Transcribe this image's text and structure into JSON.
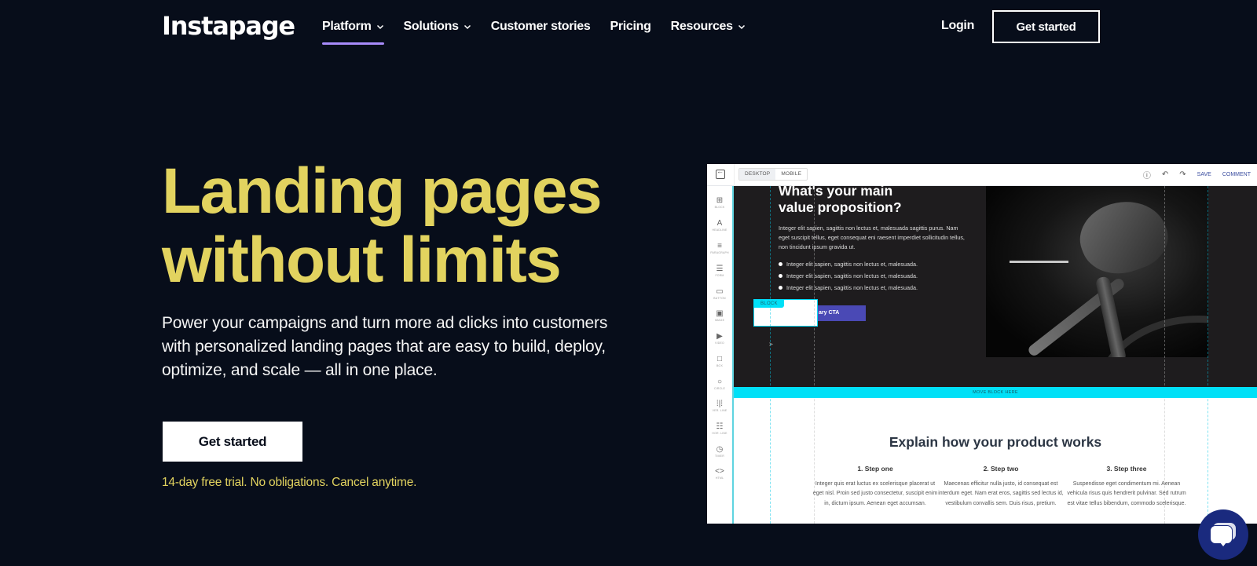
{
  "nav": {
    "logo": "Instapage",
    "items": [
      {
        "label": "Platform",
        "dropdown": true,
        "active": true
      },
      {
        "label": "Solutions",
        "dropdown": true,
        "active": false
      },
      {
        "label": "Customer stories",
        "dropdown": false,
        "active": false
      },
      {
        "label": "Pricing",
        "dropdown": false,
        "active": false
      },
      {
        "label": "Resources",
        "dropdown": true,
        "active": false
      }
    ],
    "login": "Login",
    "cta": "Get started"
  },
  "hero": {
    "title_line1": "Landing pages",
    "title_line2": "without limits",
    "subtitle": "Power your campaigns and turn more ad clicks into customers with personalized landing pages that are easy to build, deploy, optimize, and scale — all in one place.",
    "cta": "Get started",
    "trial_note": "14-day free trial. No obligations. Cancel anytime."
  },
  "editor": {
    "view_toggle": [
      "DESKTOP",
      "MOBILE"
    ],
    "active_view": "DESKTOP",
    "toolbar_right": {
      "help_icon": "question-circle-icon",
      "undo_icon": "undo-icon",
      "redo_icon": "redo-icon",
      "save": "SAVE",
      "comment": "COMMENT"
    },
    "tools": [
      {
        "label": "BLOCK",
        "icon": "block-icon",
        "glyph": "⊞"
      },
      {
        "label": "HEADLINE",
        "icon": "headline-icon",
        "glyph": "A"
      },
      {
        "label": "PARAGRAPH",
        "icon": "paragraph-icon",
        "glyph": "≡"
      },
      {
        "label": "FORM",
        "icon": "form-icon",
        "glyph": "☰"
      },
      {
        "label": "BUTTON",
        "icon": "button-icon",
        "glyph": "▭"
      },
      {
        "label": "IMAGE",
        "icon": "image-icon",
        "glyph": "▣"
      },
      {
        "label": "VIDEO",
        "icon": "video-icon",
        "glyph": "▶"
      },
      {
        "label": "BOX",
        "icon": "box-icon",
        "glyph": "□"
      },
      {
        "label": "CIRCLE",
        "icon": "circle-icon",
        "glyph": "○"
      },
      {
        "label": "VER. LINE",
        "icon": "vertical-line-icon",
        "glyph": "⁞|⁞"
      },
      {
        "label": "HOR. LINE",
        "icon": "horizontal-line-icon",
        "glyph": "☷"
      },
      {
        "label": "TIMER",
        "icon": "timer-icon",
        "glyph": "◷"
      },
      {
        "label": "HTML",
        "icon": "html-icon",
        "glyph": "<>"
      }
    ],
    "canvas": {
      "value_title_line1": "What's your main",
      "value_title_line2": "value proposition?",
      "value_body": "Integer elit sapien, sagittis non lectus et, malesuada sagittis purus. Nam eget suscipit tellus, eget consequat eni raesent imperdiet sollicitudin tellus, non tincidunt ipsum gravida ut.",
      "bullets": [
        "Integer elit sapien, sagittis non lectus et, malesuada.",
        "Integer elit sapien, sagittis non lectus et, malesuada.",
        "Integer elit sapien, sagittis non lectus et, malesuada."
      ],
      "cta_partial": "ary CTA",
      "drag_block_tag": "BLOCK",
      "move_block_label": "MOVE BLOCK HERE",
      "explain_title": "Explain how your product works",
      "steps": [
        {
          "title": "1. Step one",
          "body": "Integer quis erat luctus ex scelerisque placerat ut eget nisl. Proin sed justo consectetur, suscipit enim in, dictum ipsum. Aenean eget accumsan."
        },
        {
          "title": "2. Step two",
          "body": "Maecenas efficitur nulla justo, id consequat est interdum eget. Nam erat eros, sagittis sed lectus id, vestibulum convallis sem. Duis risus, pretium."
        },
        {
          "title": "3. Step three",
          "body": "Suspendisse eget condimentum mi. Aenean vehicula risus quis hendrerit pulvinar. Sed rutrum est vitae tellus bibendum, commodo scelerisque."
        }
      ]
    }
  },
  "chat": {
    "icon": "chat-bubbles-icon"
  },
  "colors": {
    "background": "#070d1a",
    "accent_yellow": "#e2d35f",
    "nav_underline": "#a78bfa",
    "editor_cyan": "#00e0f7",
    "cta_purple": "#4a49b5",
    "chat_blue": "#1a2a7e"
  }
}
